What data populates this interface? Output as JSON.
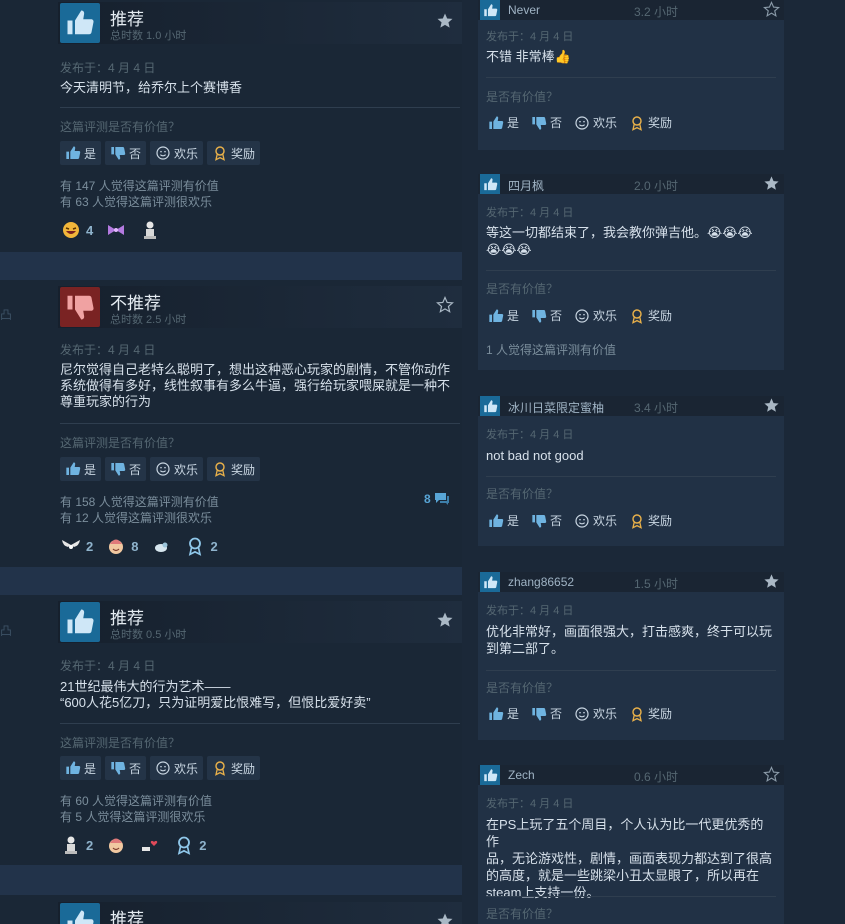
{
  "left_reviews": [
    {
      "verdict": "推荐",
      "hours": "总时数 1.0 小时",
      "posted": "发布于：4 月 4 日",
      "body": "今天清明节，给乔尔上个赛博香",
      "helpful_q": "这篇评测是否有价值？",
      "btn_yes": "是",
      "btn_no": "否",
      "btn_funny": "欢乐",
      "btn_award": "奖励",
      "helpful_count": "有 147 人觉得这篇评测有价值",
      "funny_count": "有 63 人觉得这篇评测很欢乐",
      "awards": [
        {
          "icon": "laughing-face-icon",
          "count": "4"
        },
        {
          "icon": "purple-bow-icon",
          "count": ""
        },
        {
          "icon": "figure-icon",
          "count": ""
        }
      ]
    },
    {
      "verdict": "不推荐",
      "hours": "总时数 2.5 小时",
      "posted": "发布于：4 月 4 日",
      "body_lines": [
        "尼尔觉得自己老特么聪明了，想出这种恶心玩家的剧情，不管你动作",
        "系统做得有多好，线性叙事有多么牛逼，强行给玩家喂屎就是一种不",
        "尊重玩家的行为"
      ],
      "helpful_q": "这篇评测是否有价值？",
      "btn_yes": "是",
      "btn_no": "否",
      "btn_funny": "欢乐",
      "btn_award": "奖励",
      "helpful_count": "有 158 人觉得这篇评测有价值",
      "funny_count": "有 12 人觉得这篇评测很欢乐",
      "comments": "8",
      "awards": [
        {
          "icon": "wings-icon",
          "count": "2"
        },
        {
          "icon": "smiling-face-icon",
          "count": "8"
        },
        {
          "icon": "bird-icon",
          "count": ""
        },
        {
          "icon": "ribbon-medal-icon",
          "count": "2"
        }
      ]
    },
    {
      "verdict": "推荐",
      "hours": "总时数 0.5 小时",
      "posted": "发布于：4 月 4 日",
      "body_lines": [
        "21世纪最伟大的行为艺术——",
        "“600人花5亿刀，只为证明爱比恨难写，但恨比爱好卖”"
      ],
      "helpful_q": "这篇评测是否有价值？",
      "btn_yes": "是",
      "btn_no": "否",
      "btn_funny": "欢乐",
      "btn_award": "奖励",
      "helpful_count": "有 60 人觉得这篇评测有价值",
      "funny_count": "有 5 人觉得这篇评测很欢乐",
      "awards": [
        {
          "icon": "figure-icon",
          "count": "2"
        },
        {
          "icon": "smiling-face-icon",
          "count": ""
        },
        {
          "icon": "heart-hand-icon",
          "count": ""
        },
        {
          "icon": "ribbon-medal-icon",
          "count": "2"
        }
      ]
    },
    {
      "verdict": "推荐"
    }
  ],
  "left_edge_glyph": "凸",
  "right_reviews": [
    {
      "name": "Never",
      "hours": "3.2 小时",
      "posted": "发布于：4 月 4 日",
      "body_lines": [
        "不错 非常棒👍"
      ],
      "helpful_q": "是否有价值？",
      "btn_yes": "是",
      "btn_no": "否",
      "btn_funny": "欢乐",
      "btn_award": "奖励"
    },
    {
      "name": "四月枫",
      "hours": "2.0 小时",
      "posted": "发布于：4 月 4 日",
      "body_lines": [
        "等这一切都结束了，我会教你弹吉他。😭😭😭",
        "😭😭😭"
      ],
      "helpful_q": "是否有价值？",
      "btn_yes": "是",
      "btn_no": "否",
      "btn_funny": "欢乐",
      "btn_award": "奖励",
      "helpful_count": "1 人觉得这篇评测有价值"
    },
    {
      "name": "冰川日菜限定蜜柚",
      "hours": "3.4 小时",
      "posted": "发布于：4 月 4 日",
      "body_lines": [
        "not bad not good"
      ],
      "helpful_q": "是否有价值？",
      "btn_yes": "是",
      "btn_no": "否",
      "btn_funny": "欢乐",
      "btn_award": "奖励"
    },
    {
      "name": "zhang86652",
      "hours": "1.5 小时",
      "posted": "发布于：4 月 4 日",
      "body_lines": [
        "优化非常好，画面很强大，打击感爽，终于可以玩",
        "到第二部了。"
      ],
      "helpful_q": "是否有价值？",
      "btn_yes": "是",
      "btn_no": "否",
      "btn_funny": "欢乐",
      "btn_award": "奖励"
    },
    {
      "name": "Zech",
      "hours": "0.6 小时",
      "posted": "发布于：4 月 4 日",
      "body_lines": [
        "在PS上玩了五个周目，个人认为比一代更优秀的作",
        "品，无论游戏性，剧情，画面表现力都达到了很高",
        "的高度，就是一些跳梁小丑太显眼了，所以再在",
        "steam上支持一份。"
      ],
      "helpful_q": "是否有价值？"
    }
  ],
  "colors": {
    "accent": "#58a5d6",
    "thumb_up": "#1a6a98",
    "thumb_down": "#7a2323",
    "award_gold": "#e8b04a"
  }
}
